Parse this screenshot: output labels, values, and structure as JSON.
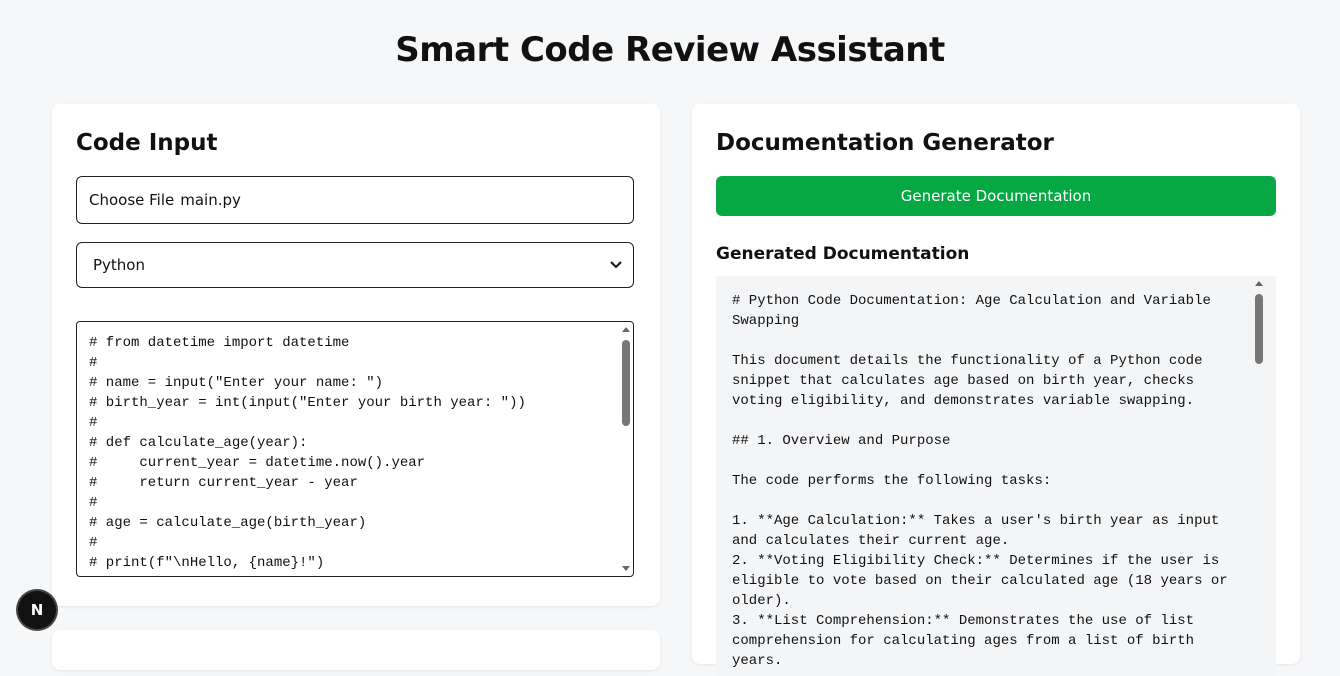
{
  "page": {
    "title": "Smart Code Review Assistant"
  },
  "code_input": {
    "title": "Code Input",
    "file_button": "Choose File",
    "file_name": "main.py",
    "language": "Python",
    "code": "# from datetime import datetime\n#\n# name = input(\"Enter your name: \")\n# birth_year = int(input(\"Enter your birth year: \"))\n#\n# def calculate_age(year):\n#     current_year = datetime.now().year\n#     return current_year - year\n#\n# age = calculate_age(birth_year)\n#\n# print(f\"\\nHello, {name}!\")"
  },
  "doc_generator": {
    "title": "Documentation Generator",
    "button_label": "Generate Documentation",
    "output_heading": "Generated Documentation",
    "output": "# Python Code Documentation: Age Calculation and Variable Swapping\n\nThis document details the functionality of a Python code snippet that calculates age based on birth year, checks voting eligibility, and demonstrates variable swapping.\n\n## 1. Overview and Purpose\n\nThe code performs the following tasks:\n\n1. **Age Calculation:** Takes a user's birth year as input and calculates their current age.\n2. **Voting Eligibility Check:** Determines if the user is eligible to vote based on their calculated age (18 years or older).\n3. **List Comprehension:** Demonstrates the use of list comprehension for calculating ages from a list of birth years."
  },
  "badge": {
    "letter": "N"
  },
  "colors": {
    "accent_green": "#05a843",
    "background": "#f6f7f9",
    "dark": "#111111"
  }
}
